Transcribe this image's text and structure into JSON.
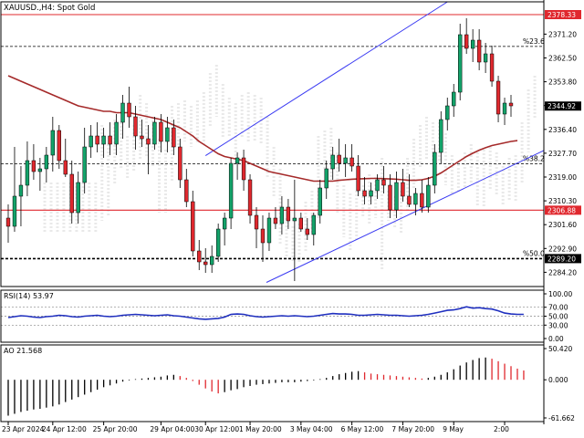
{
  "chart_data": [
    {
      "type": "candlestick",
      "panel": "price",
      "title": "XAUUSD.,H4:  Spot Gold",
      "ylim": [
        2279.0,
        2383.0
      ],
      "y_ticks": [
        "2371.20",
        "2362.50",
        "2353.80",
        "2345.10",
        "2336.40",
        "2327.70",
        "2319.00",
        "2310.30",
        "2301.60",
        "2292.90",
        "2284.20"
      ],
      "price_tags": [
        {
          "label": "2378.33",
          "value": 2378.33,
          "color": "#e0282e"
        },
        {
          "label": "2344.92",
          "value": 2344.92,
          "color": "#000000"
        },
        {
          "label": "2306.88",
          "value": 2306.88,
          "color": "#e0282e"
        },
        {
          "label": "2289.20",
          "value": 2289.2,
          "color": "#000000"
        }
      ],
      "fib_levels": [
        {
          "label": "%23.6",
          "value": 2366.7
        },
        {
          "label": "%38.2",
          "value": 2323.8
        },
        {
          "label": "%50.0",
          "value": 2289.2
        }
      ],
      "candles": [
        {
          "o": 2304,
          "h": 2309,
          "l": 2295,
          "c": 2301
        },
        {
          "o": 2301,
          "h": 2330,
          "l": 2299,
          "c": 2312
        },
        {
          "o": 2312,
          "h": 2323,
          "l": 2301,
          "c": 2316
        },
        {
          "o": 2316,
          "h": 2332,
          "l": 2312,
          "c": 2325
        },
        {
          "o": 2325,
          "h": 2331,
          "l": 2318,
          "c": 2321
        },
        {
          "o": 2321,
          "h": 2326,
          "l": 2314,
          "c": 2322
        },
        {
          "o": 2322,
          "h": 2330,
          "l": 2317,
          "c": 2327
        },
        {
          "o": 2327,
          "h": 2341,
          "l": 2321,
          "c": 2336
        },
        {
          "o": 2336,
          "h": 2338,
          "l": 2322,
          "c": 2325
        },
        {
          "o": 2325,
          "h": 2333,
          "l": 2319,
          "c": 2320
        },
        {
          "o": 2320,
          "h": 2325,
          "l": 2302,
          "c": 2306
        },
        {
          "o": 2306,
          "h": 2321,
          "l": 2302,
          "c": 2317
        },
        {
          "o": 2317,
          "h": 2337,
          "l": 2313,
          "c": 2330
        },
        {
          "o": 2330,
          "h": 2338,
          "l": 2326,
          "c": 2334
        },
        {
          "o": 2334,
          "h": 2339,
          "l": 2328,
          "c": 2331
        },
        {
          "o": 2331,
          "h": 2337,
          "l": 2326,
          "c": 2334
        },
        {
          "o": 2334,
          "h": 2339,
          "l": 2327,
          "c": 2331
        },
        {
          "o": 2331,
          "h": 2342,
          "l": 2327,
          "c": 2339
        },
        {
          "o": 2339,
          "h": 2349,
          "l": 2333,
          "c": 2346
        },
        {
          "o": 2346,
          "h": 2352,
          "l": 2337,
          "c": 2341
        },
        {
          "o": 2341,
          "h": 2345,
          "l": 2329,
          "c": 2334
        },
        {
          "o": 2334,
          "h": 2340,
          "l": 2330,
          "c": 2333
        },
        {
          "o": 2333,
          "h": 2338,
          "l": 2320,
          "c": 2331
        },
        {
          "o": 2331,
          "h": 2341,
          "l": 2329,
          "c": 2339
        },
        {
          "o": 2339,
          "h": 2342,
          "l": 2328,
          "c": 2332
        },
        {
          "o": 2332,
          "h": 2341,
          "l": 2328,
          "c": 2337
        },
        {
          "o": 2337,
          "h": 2340,
          "l": 2327,
          "c": 2330
        },
        {
          "o": 2330,
          "h": 2333,
          "l": 2315,
          "c": 2318
        },
        {
          "o": 2318,
          "h": 2322,
          "l": 2308,
          "c": 2310
        },
        {
          "o": 2310,
          "h": 2314,
          "l": 2290,
          "c": 2292
        },
        {
          "o": 2292,
          "h": 2296,
          "l": 2285,
          "c": 2288
        },
        {
          "o": 2288,
          "h": 2293,
          "l": 2284,
          "c": 2287
        },
        {
          "o": 2287,
          "h": 2294,
          "l": 2284,
          "c": 2290
        },
        {
          "o": 2290,
          "h": 2302,
          "l": 2288,
          "c": 2300
        },
        {
          "o": 2300,
          "h": 2306,
          "l": 2294,
          "c": 2304
        },
        {
          "o": 2304,
          "h": 2326,
          "l": 2300,
          "c": 2324
        },
        {
          "o": 2324,
          "h": 2328,
          "l": 2318,
          "c": 2326
        },
        {
          "o": 2326,
          "h": 2329,
          "l": 2314,
          "c": 2318
        },
        {
          "o": 2318,
          "h": 2320,
          "l": 2302,
          "c": 2305
        },
        {
          "o": 2305,
          "h": 2308,
          "l": 2293,
          "c": 2300
        },
        {
          "o": 2300,
          "h": 2305,
          "l": 2288,
          "c": 2295
        },
        {
          "o": 2295,
          "h": 2306,
          "l": 2292,
          "c": 2304
        },
        {
          "o": 2304,
          "h": 2308,
          "l": 2300,
          "c": 2302
        },
        {
          "o": 2302,
          "h": 2312,
          "l": 2298,
          "c": 2308
        },
        {
          "o": 2308,
          "h": 2311,
          "l": 2300,
          "c": 2303
        },
        {
          "o": 2303,
          "h": 2318,
          "l": 2281,
          "c": 2304
        },
        {
          "o": 2304,
          "h": 2306,
          "l": 2299,
          "c": 2300
        },
        {
          "o": 2300,
          "h": 2304,
          "l": 2296,
          "c": 2298
        },
        {
          "o": 2298,
          "h": 2306,
          "l": 2294,
          "c": 2305
        },
        {
          "o": 2305,
          "h": 2318,
          "l": 2302,
          "c": 2315
        },
        {
          "o": 2315,
          "h": 2325,
          "l": 2311,
          "c": 2322
        },
        {
          "o": 2322,
          "h": 2330,
          "l": 2318,
          "c": 2327
        },
        {
          "o": 2327,
          "h": 2333,
          "l": 2321,
          "c": 2324
        },
        {
          "o": 2324,
          "h": 2331,
          "l": 2319,
          "c": 2326
        },
        {
          "o": 2326,
          "h": 2331,
          "l": 2321,
          "c": 2323
        },
        {
          "o": 2323,
          "h": 2327,
          "l": 2312,
          "c": 2314
        },
        {
          "o": 2314,
          "h": 2319,
          "l": 2309,
          "c": 2312
        },
        {
          "o": 2312,
          "h": 2317,
          "l": 2309,
          "c": 2314
        },
        {
          "o": 2314,
          "h": 2320,
          "l": 2311,
          "c": 2318
        },
        {
          "o": 2318,
          "h": 2323,
          "l": 2313,
          "c": 2316
        },
        {
          "o": 2316,
          "h": 2320,
          "l": 2304,
          "c": 2307
        },
        {
          "o": 2307,
          "h": 2321,
          "l": 2304,
          "c": 2317
        },
        {
          "o": 2317,
          "h": 2322,
          "l": 2310,
          "c": 2312
        },
        {
          "o": 2312,
          "h": 2320,
          "l": 2308,
          "c": 2309
        },
        {
          "o": 2309,
          "h": 2315,
          "l": 2305,
          "c": 2313
        },
        {
          "o": 2313,
          "h": 2318,
          "l": 2306,
          "c": 2308
        },
        {
          "o": 2308,
          "h": 2319,
          "l": 2306,
          "c": 2316
        },
        {
          "o": 2316,
          "h": 2331,
          "l": 2313,
          "c": 2328
        },
        {
          "o": 2328,
          "h": 2343,
          "l": 2324,
          "c": 2340
        },
        {
          "o": 2340,
          "h": 2348,
          "l": 2336,
          "c": 2345
        },
        {
          "o": 2345,
          "h": 2353,
          "l": 2341,
          "c": 2350
        },
        {
          "o": 2350,
          "h": 2375,
          "l": 2347,
          "c": 2371
        },
        {
          "o": 2371,
          "h": 2377,
          "l": 2364,
          "c": 2366
        },
        {
          "o": 2366,
          "h": 2373,
          "l": 2361,
          "c": 2369
        },
        {
          "o": 2369,
          "h": 2373,
          "l": 2358,
          "c": 2361
        },
        {
          "o": 2361,
          "h": 2368,
          "l": 2357,
          "c": 2364
        },
        {
          "o": 2364,
          "h": 2367,
          "l": 2352,
          "c": 2354
        },
        {
          "o": 2354,
          "h": 2356,
          "l": 2339,
          "c": 2342
        },
        {
          "o": 2342,
          "h": 2348,
          "l": 2338,
          "c": 2346
        },
        {
          "o": 2346,
          "h": 2349,
          "l": 2341,
          "c": 2345
        }
      ],
      "ma_line": [
        2356,
        2355,
        2354,
        2353,
        2352,
        2351,
        2350,
        2349,
        2348,
        2347,
        2346,
        2345,
        2344.5,
        2344,
        2343.5,
        2343,
        2343,
        2342.5,
        2342.5,
        2342.5,
        2342,
        2341.5,
        2341,
        2340.5,
        2340,
        2339,
        2338,
        2337,
        2335.5,
        2334,
        2332,
        2330.5,
        2329,
        2327.5,
        2326.5,
        2326,
        2325.5,
        2325,
        2324,
        2323,
        2322,
        2321,
        2320.5,
        2320,
        2319.5,
        2319,
        2318.5,
        2318,
        2317.5,
        2317.5,
        2317.5,
        2317.5,
        2317.8,
        2318,
        2318.2,
        2318.3,
        2318.4,
        2318.5,
        2318.5,
        2318.4,
        2318.3,
        2318.2,
        2318,
        2317.8,
        2317.8,
        2318,
        2318.5,
        2319.3,
        2320.5,
        2322,
        2323.5,
        2325,
        2326.5,
        2327.7,
        2328.8,
        2329.7,
        2330.5,
        2331,
        2331.5,
        2332,
        2332.3
      ],
      "x_tick_labels": [
        "23 Apr 2024",
        "24 Apr 12:00",
        "25 Apr 20:00",
        "29 Apr 04:00",
        "30 Apr 12:00",
        "1 May 20:00",
        "3 May 04:00",
        "6 May 12:00",
        "7 May 20:00",
        "9 May",
        "2:00"
      ]
    },
    {
      "type": "line",
      "panel": "rsi",
      "label": "RSI(14) 53.97",
      "ylim": [
        0,
        100
      ],
      "y_ticks": [
        "100.00",
        "70.00",
        "50.00",
        "30.00",
        "0.00"
      ],
      "levels": [
        70,
        30
      ],
      "values": [
        47,
        49,
        51,
        50,
        48,
        47,
        49,
        50,
        52,
        51,
        49,
        48,
        50,
        51,
        52,
        50,
        49,
        50,
        52,
        53,
        54,
        53,
        52,
        51,
        52,
        53,
        51,
        50,
        48,
        46,
        44,
        43,
        44,
        45,
        48,
        54,
        55,
        54,
        51,
        49,
        48,
        49,
        50,
        51,
        50,
        51,
        50,
        49,
        50,
        52,
        54,
        56,
        55,
        55,
        54,
        52,
        52,
        53,
        54,
        53,
        52,
        52,
        51,
        50,
        51,
        52,
        54,
        57,
        60,
        63,
        64,
        67,
        71,
        68,
        69,
        67,
        66,
        62,
        57,
        55,
        54,
        54
      ]
    },
    {
      "type": "bar",
      "panel": "ao",
      "label": "AO 21.568",
      "ylim": [
        -61.662,
        50.42
      ],
      "y_ticks": [
        "50.420",
        "0.000",
        "-61.662"
      ],
      "values": [
        -58,
        -55,
        -52,
        -50,
        -48,
        -47,
        -45,
        -43,
        -40,
        -36,
        -32,
        -28,
        -24,
        -20,
        -16,
        -12,
        -9,
        -6,
        -3,
        -1,
        1,
        2,
        3,
        4,
        5,
        7,
        8,
        6,
        3,
        -2,
        -8,
        -14,
        -19,
        -22,
        -20,
        -17,
        -15,
        -12,
        -10,
        -8,
        -7,
        -6,
        -5,
        -4,
        -4,
        -4,
        -3,
        -2,
        -1,
        1,
        3,
        6,
        9,
        11,
        13,
        14,
        12,
        10,
        9,
        8,
        7,
        6,
        5,
        4,
        3,
        2,
        3,
        5,
        8,
        12,
        17,
        23,
        28,
        32,
        35,
        36,
        34,
        30,
        26,
        22,
        18,
        15
      ]
    }
  ]
}
